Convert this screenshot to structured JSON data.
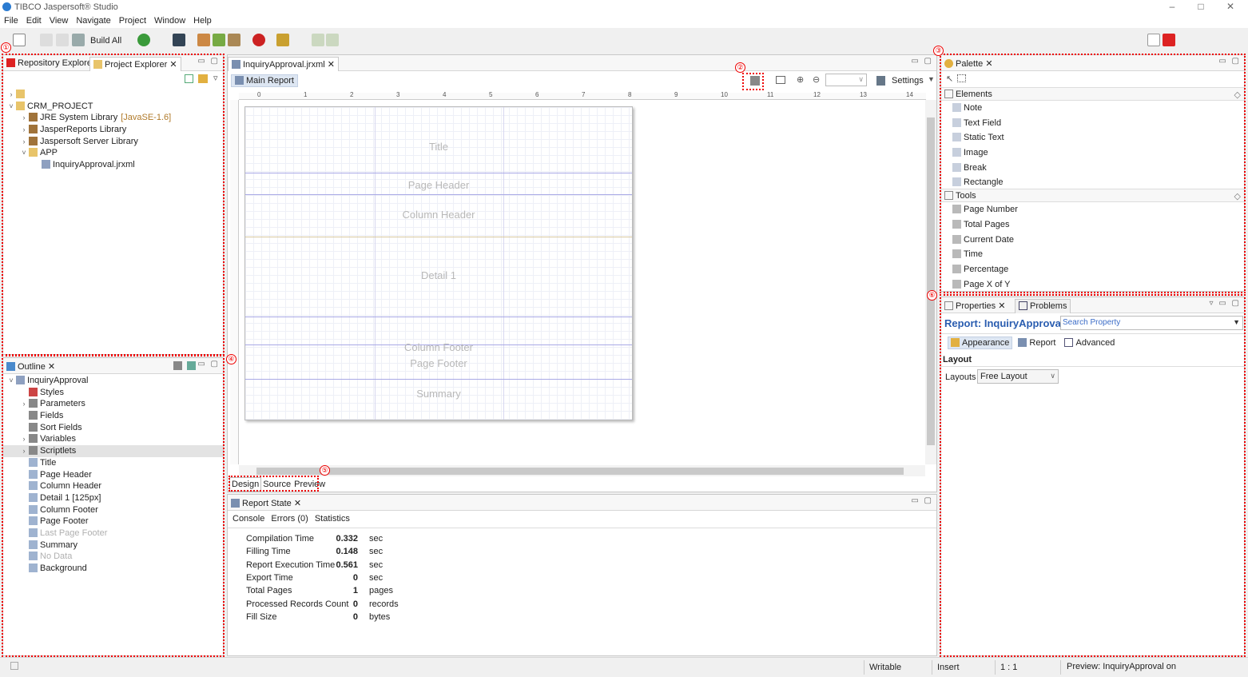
{
  "window": {
    "title": "TIBCO Jaspersoft® Studio",
    "minimize": "–",
    "maximize": "□",
    "close": "✕"
  },
  "menu": [
    "File",
    "Edit",
    "View",
    "Navigate",
    "Project",
    "Window",
    "Help"
  ],
  "toolbar": {
    "build_all": "Build All"
  },
  "callouts": [
    "①",
    "②",
    "③",
    "④",
    "⑤",
    "⑥"
  ],
  "explorer": {
    "tabs": [
      "Repository Explorer",
      "Project Explorer"
    ],
    "items": [
      {
        "label": "",
        "level": 0,
        "arrow": "›"
      },
      {
        "label": "CRM_PROJECT",
        "level": 0,
        "arrow": "˅"
      },
      {
        "label": "JRE System Library",
        "suffix": "[JavaSE-1.6]",
        "level": 1,
        "arrow": "›"
      },
      {
        "label": "JasperReports Library",
        "level": 1,
        "arrow": "›"
      },
      {
        "label": "Jaspersoft Server Library",
        "level": 1,
        "arrow": "›"
      },
      {
        "label": "APP",
        "level": 1,
        "arrow": "˅"
      },
      {
        "label": "InquiryApproval.jrxml",
        "level": 2,
        "arrow": ""
      }
    ]
  },
  "outline": {
    "tab": "Outline",
    "items": [
      {
        "label": "InquiryApproval",
        "level": 0,
        "arrow": "˅"
      },
      {
        "label": "Styles",
        "level": 1,
        "arrow": ""
      },
      {
        "label": "Parameters",
        "level": 1,
        "arrow": "›"
      },
      {
        "label": "Fields",
        "level": 1,
        "arrow": ""
      },
      {
        "label": "Sort Fields",
        "level": 1,
        "arrow": ""
      },
      {
        "label": "Variables",
        "level": 1,
        "arrow": "›"
      },
      {
        "label": "Scriptlets",
        "level": 1,
        "arrow": "›"
      },
      {
        "label": "Title",
        "level": 1,
        "arrow": ""
      },
      {
        "label": "Page Header",
        "level": 1,
        "arrow": ""
      },
      {
        "label": "Column Header",
        "level": 1,
        "arrow": ""
      },
      {
        "label": "Detail 1 [125px]",
        "level": 1,
        "arrow": ""
      },
      {
        "label": "Column Footer",
        "level": 1,
        "arrow": ""
      },
      {
        "label": "Page Footer",
        "level": 1,
        "arrow": ""
      },
      {
        "label": "Last Page Footer",
        "level": 1,
        "arrow": "",
        "muted": true
      },
      {
        "label": "Summary",
        "level": 1,
        "arrow": ""
      },
      {
        "label": "No Data",
        "level": 1,
        "arrow": "",
        "muted": true
      },
      {
        "label": "Background",
        "level": 1,
        "arrow": ""
      }
    ]
  },
  "editor": {
    "tab": "InquiryApproval.jrxml",
    "main_report": "Main Report",
    "settings": "Settings",
    "ruler_numbers": [
      "0",
      "1",
      "2",
      "3",
      "4",
      "5",
      "6",
      "7",
      "8",
      "9",
      "10",
      "11",
      "12",
      "13",
      "14"
    ],
    "bands": [
      "Title",
      "Page Header",
      "Column Header",
      "Detail 1",
      "Column Footer",
      "Page Footer",
      "Summary"
    ],
    "bottom_tabs": [
      "Design",
      "Source",
      "Preview"
    ]
  },
  "report_state": {
    "tab": "Report State",
    "subtabs": [
      "Console",
      "Errors (0)",
      "Statistics"
    ],
    "stats": [
      {
        "label": "Compilation Time",
        "value": "0.332",
        "unit": "sec"
      },
      {
        "label": "Filling Time",
        "value": "0.148",
        "unit": "sec"
      },
      {
        "label": "Report Execution Time",
        "value": "0.561",
        "unit": "sec"
      },
      {
        "label": "Export Time",
        "value": "0",
        "unit": "sec"
      },
      {
        "label": "Total Pages",
        "value": "1",
        "unit": "pages"
      },
      {
        "label": "Processed Records Count",
        "value": "0",
        "unit": "records"
      },
      {
        "label": "Fill Size",
        "value": "0",
        "unit": "bytes"
      }
    ]
  },
  "palette": {
    "tab": "Palette",
    "elements_header": "Elements",
    "elements": [
      "Note",
      "Text Field",
      "Static Text",
      "Image",
      "Break",
      "Rectangle"
    ],
    "tools_header": "Tools",
    "tools": [
      "Page Number",
      "Total Pages",
      "Current Date",
      "Time",
      "Percentage",
      "Page X of Y"
    ]
  },
  "properties": {
    "tabs": [
      "Properties",
      "Problems"
    ],
    "title": "Report: InquiryApproval",
    "search_placeholder": "Search Property",
    "subtabs": [
      "Appearance",
      "Report",
      "Advanced"
    ],
    "section": "Layout",
    "layouts_label": "Layouts",
    "layouts_value": "Free Layout"
  },
  "status": {
    "writable": "Writable",
    "insert": "Insert",
    "position": "1 : 1",
    "preview": "Preview: InquiryApproval on"
  }
}
